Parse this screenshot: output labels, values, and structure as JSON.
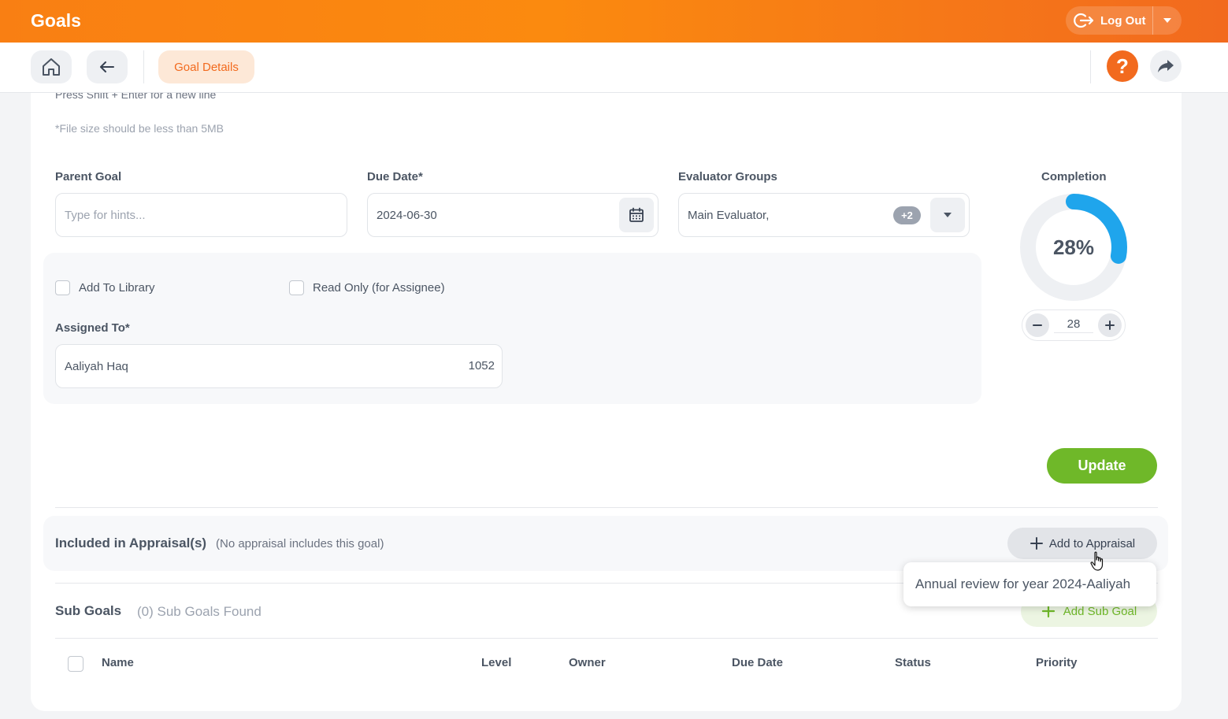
{
  "app": {
    "title": "Goals"
  },
  "header": {
    "logout_label": "Log Out"
  },
  "subnav": {
    "tab_label": "Goal Details",
    "help_label": "?"
  },
  "form": {
    "shift_enter_hint": "Press Shift + Enter for a new line",
    "file_size_hint": "*File size should be less than 5MB",
    "parent_goal": {
      "label": "Parent Goal",
      "placeholder": "Type for hints..."
    },
    "due_date": {
      "label": "Due Date*",
      "value": "2024-06-30"
    },
    "evaluator_groups": {
      "label": "Evaluator Groups",
      "value": "Main Evaluator,",
      "extra_count": "+2"
    },
    "add_to_library": {
      "label": "Add To Library",
      "checked": false
    },
    "read_only": {
      "label": "Read Only (for Assignee)",
      "checked": false
    },
    "assigned_to": {
      "label": "Assigned To*",
      "name": "Aaliyah Haq",
      "id": "1052"
    },
    "update_label": "Update"
  },
  "completion": {
    "label": "Completion",
    "percent": 28,
    "percent_text": "28%",
    "stepper_value": "28",
    "color": "#1fa5ec"
  },
  "appraisals": {
    "title": "Included in Appraisal(s)",
    "note": "(No appraisal includes this goal)",
    "add_label": "Add to Appraisal",
    "dropdown_option": "Annual review for year 2024-Aaliyah"
  },
  "sub_goals": {
    "title": "Sub Goals",
    "count_text": "(0) Sub Goals Found",
    "add_label": "Add Sub Goal",
    "columns": [
      "Name",
      "Level",
      "Owner",
      "Due Date",
      "Status",
      "Priority"
    ]
  },
  "colors": {
    "brand_orange": "#f97f13",
    "accent_green": "#6fb829",
    "progress_blue": "#1fa5ec"
  }
}
